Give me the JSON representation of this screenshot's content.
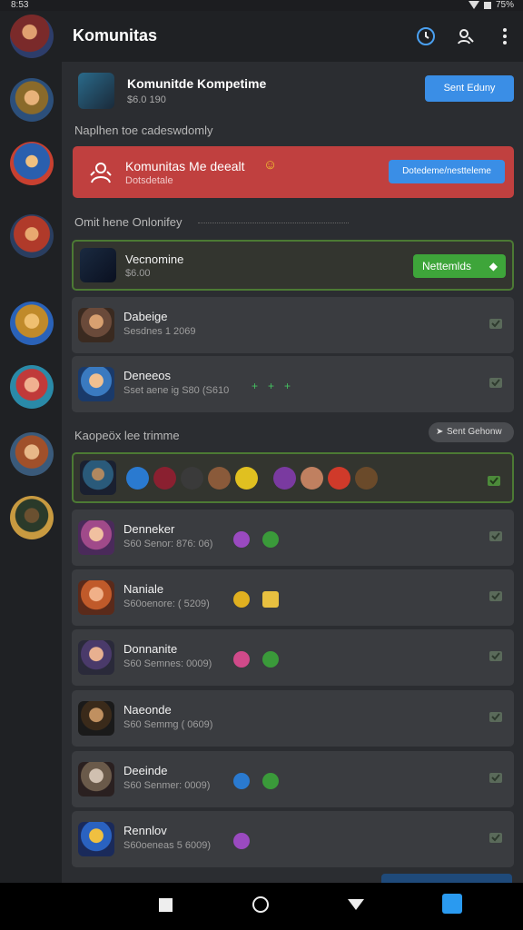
{
  "status": {
    "time": "8:53",
    "battery": "75%"
  },
  "header": {
    "title": "Komunitas"
  },
  "top_item": {
    "name": "Komunitde Kompetime",
    "sub": "$6.0 190",
    "button": "Sent Eduny"
  },
  "section1": {
    "label": "Naplhen toe cadeswdomly"
  },
  "alert": {
    "title": "Komunitas Me deealt",
    "sub": "Dotsdetale",
    "button": "Dotedeme/nestteleme"
  },
  "section2": {
    "label": "Omit hene Onlonifey"
  },
  "featured": {
    "name": "Vecnomine",
    "sub": "$6.00",
    "button": "Nettemlds"
  },
  "section3": {
    "label": "Kaopeöx lee trimme",
    "button": "Sent Gehonw"
  },
  "members": [
    {
      "name": "Dabeige",
      "sub": "Sesdnes 1 2069"
    },
    {
      "name": "Deneeos",
      "sub": "Sset aene ig  S80 (S610"
    },
    {
      "name": "Denneker",
      "sub": "S60 Senor: 876: 06)"
    },
    {
      "name": "Naniale",
      "sub": "S60oenore: ( 5209)"
    },
    {
      "name": "Donnanite",
      "sub": "S60 Semnes: 0009)"
    },
    {
      "name": "Naeonde",
      "sub": "S60 Semmg ( 0609)"
    },
    {
      "name": "Deeinde",
      "sub": "S60 Senmer: 0009)"
    },
    {
      "name": "Rennlov",
      "sub": "S60oeneas 5 6009)"
    }
  ],
  "colors": {
    "accent_blue": "#3a8ee6",
    "alert_red": "#c0403f",
    "green": "#3ea53a"
  }
}
